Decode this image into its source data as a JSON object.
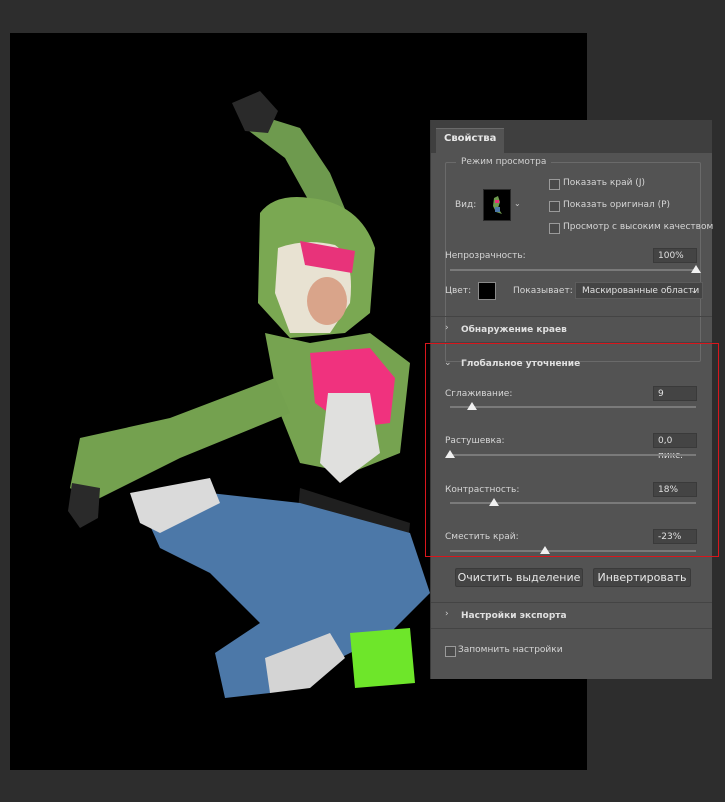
{
  "panel": {
    "tab_label": "Свойства",
    "view_mode": {
      "group_title": "Режим просмотра",
      "view_label": "Вид:",
      "checkboxes": [
        {
          "label": "Показать край (J)",
          "checked": false
        },
        {
          "label": "Показать оригинал (P)",
          "checked": false
        },
        {
          "label": "Просмотр с высоким качеством",
          "checked": false
        }
      ],
      "opacity_label": "Непрозрачность:",
      "opacity_value": "100%",
      "opacity_level": 1.0,
      "color_label": "Цвет:",
      "color_value": "#000000",
      "shows_label": "Показывает:",
      "shows_value": "Маскированные области"
    },
    "edge_detection": {
      "title": "Обнаружение краев"
    },
    "global_refinement": {
      "title": "Глобальное уточнение",
      "smooth_label": "Сглаживание:",
      "smooth_value": "9",
      "smooth_level": 0.09,
      "feather_label": "Растушевка:",
      "feather_value": "0,0 пикс.",
      "feather_level": 0.0,
      "contrast_label": "Контрастность:",
      "contrast_value": "18%",
      "contrast_level": 0.18,
      "shift_label": "Сместить край:",
      "shift_value": "-23%",
      "shift_level": 0.385
    },
    "buttons": {
      "clear": "Очистить выделение",
      "invert": "Инвертировать"
    },
    "export": {
      "title": "Настройки экспорта"
    },
    "remember": {
      "label": "Запомнить настройки",
      "checked": false
    }
  }
}
